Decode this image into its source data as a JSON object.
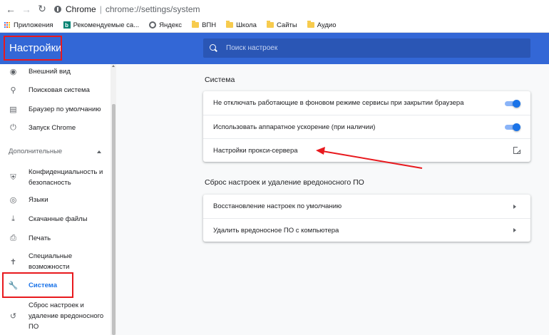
{
  "address_bar": {
    "host": "Chrome",
    "separator": "|",
    "path": "chrome://settings/system"
  },
  "bookmarks": [
    {
      "label": "Приложения",
      "icon": "apps-grid-icon"
    },
    {
      "label": "Рекомендуемые са...",
      "icon": "bing-icon"
    },
    {
      "label": "Яндекс",
      "icon": "globe-icon"
    },
    {
      "label": "ВПН",
      "icon": "folder-icon"
    },
    {
      "label": "Школа",
      "icon": "folder-icon"
    },
    {
      "label": "Сайты",
      "icon": "folder-icon"
    },
    {
      "label": "Аудио",
      "icon": "folder-icon"
    }
  ],
  "header": {
    "title": "Настройки",
    "search_placeholder": "Поиск настроек"
  },
  "sidebar": {
    "items": [
      {
        "label": "Внешний вид",
        "icon": "palette-icon"
      },
      {
        "label": "Поисковая система",
        "icon": "search-icon"
      },
      {
        "label": "Браузер по умолчанию",
        "icon": "browser-icon"
      },
      {
        "label": "Запуск Chrome",
        "icon": "power-icon"
      }
    ],
    "section_label": "Дополнительные",
    "advanced_items": [
      {
        "label": "Конфиденциальность и безопасность",
        "icon": "shield-icon"
      },
      {
        "label": "Языки",
        "icon": "globe-icon"
      },
      {
        "label": "Скачанные файлы",
        "icon": "download-icon"
      },
      {
        "label": "Печать",
        "icon": "printer-icon"
      },
      {
        "label": "Специальные возможности",
        "icon": "accessibility-icon"
      },
      {
        "label": "Система",
        "icon": "wrench-icon"
      },
      {
        "label": "Сброс настроек и удаление вредоносного ПО",
        "icon": "history-icon"
      }
    ]
  },
  "main": {
    "system_title": "Система",
    "system_rows": [
      {
        "label": "Не отключать работающие в фоновом режиме сервисы при закрытии браузера",
        "toggle": "on"
      },
      {
        "label": "Использовать аппаратное ускорение (при наличии)",
        "toggle": "on"
      },
      {
        "label": "Настройки прокси-сервера",
        "icon": "open-in-new-icon"
      }
    ],
    "reset_title": "Сброс настроек и удаление вредоносного ПО",
    "reset_rows": [
      {
        "label": "Восстановление настроек по умолчанию"
      },
      {
        "label": "Удалить вредоносное ПО с компьютера"
      }
    ]
  },
  "colors": {
    "header_blue": "#3367d6",
    "accent": "#1a73e8",
    "annotation_red": "#e8191e"
  }
}
